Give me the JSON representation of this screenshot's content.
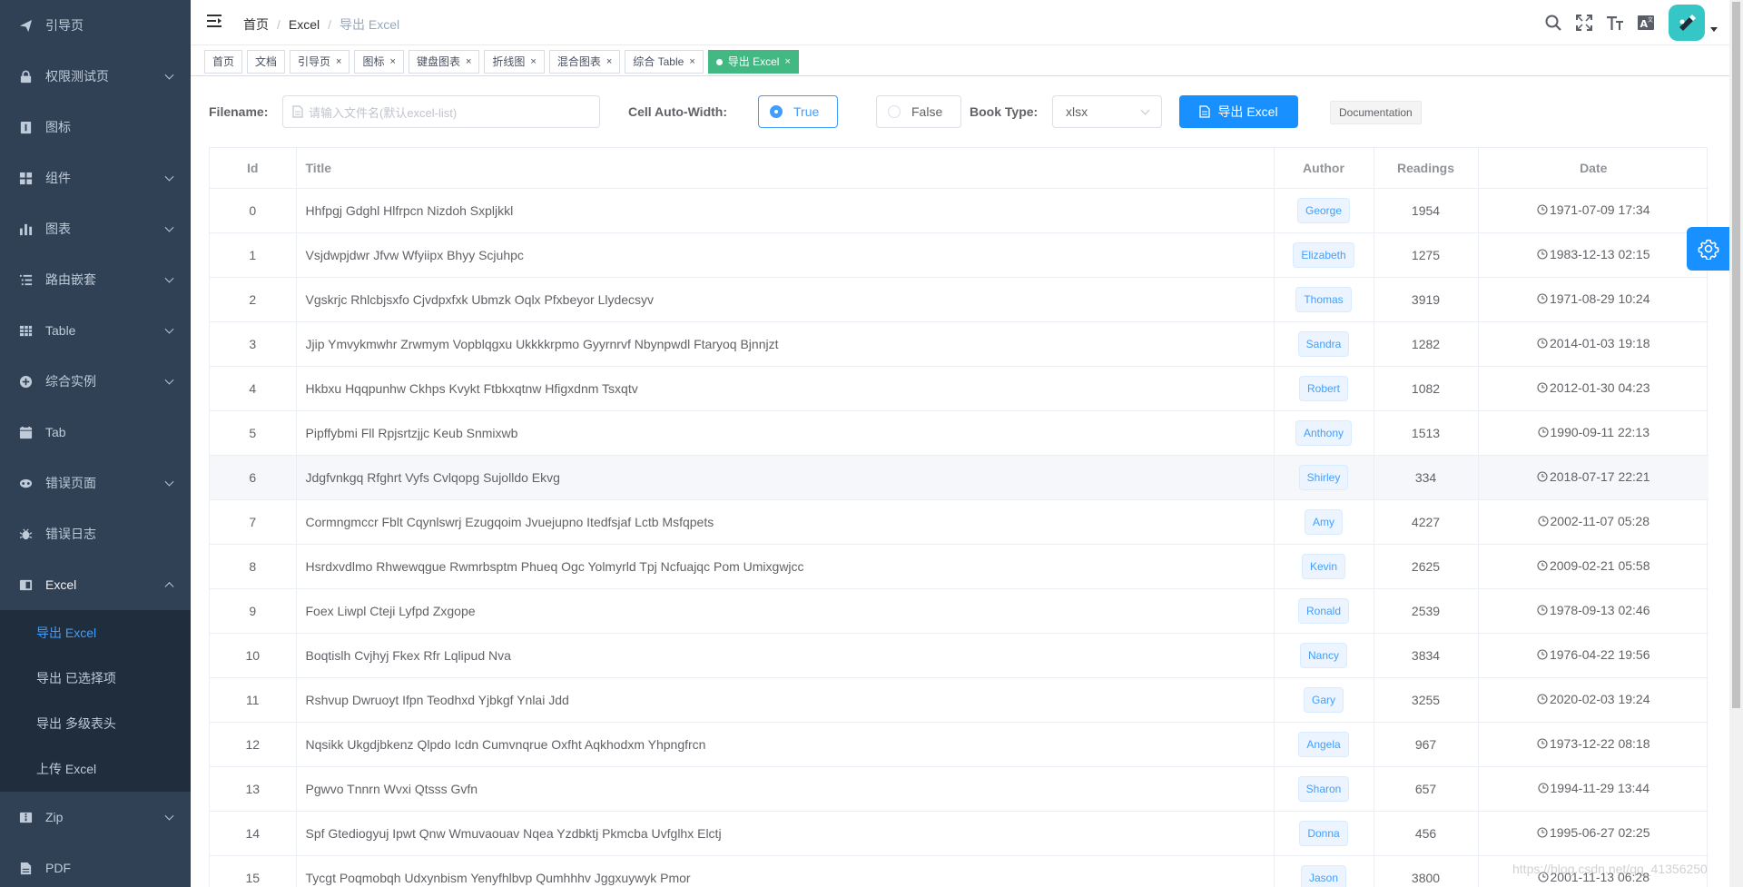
{
  "sidebar": {
    "items": [
      {
        "label": "引导页",
        "icon": "send-icon",
        "arrow": false
      },
      {
        "label": "权限测试页",
        "icon": "lock-icon",
        "arrow": true
      },
      {
        "label": "图标",
        "icon": "icon-icon",
        "arrow": false
      },
      {
        "label": "组件",
        "icon": "component-icon",
        "arrow": true
      },
      {
        "label": "图表",
        "icon": "chart-icon",
        "arrow": true
      },
      {
        "label": "路由嵌套",
        "icon": "nested-icon",
        "arrow": true
      },
      {
        "label": "Table",
        "icon": "table-icon",
        "arrow": true
      },
      {
        "label": "综合实例",
        "icon": "example-icon",
        "arrow": true
      },
      {
        "label": "Tab",
        "icon": "tab-icon",
        "arrow": false
      },
      {
        "label": "错误页面",
        "icon": "404-icon",
        "arrow": true
      },
      {
        "label": "错误日志",
        "icon": "bug-icon",
        "arrow": false
      },
      {
        "label": "Excel",
        "icon": "excel-icon",
        "arrow": true,
        "open": true
      }
    ],
    "excel_sub": [
      "导出 Excel",
      "导出 已选择项",
      "导出 多级表头",
      "上传 Excel"
    ],
    "after": [
      {
        "label": "Zip",
        "icon": "zip-icon",
        "arrow": true
      },
      {
        "label": "PDF",
        "icon": "pdf-icon",
        "arrow": false
      }
    ]
  },
  "navbar": {
    "breadcrumb": [
      "首页",
      "Excel",
      "导出 Excel"
    ]
  },
  "tags": [
    {
      "label": "首页",
      "closable": false
    },
    {
      "label": "文档",
      "closable": false
    },
    {
      "label": "引导页",
      "closable": true
    },
    {
      "label": "图标",
      "closable": true
    },
    {
      "label": "键盘图表",
      "closable": true
    },
    {
      "label": "折线图",
      "closable": true
    },
    {
      "label": "混合图表",
      "closable": true
    },
    {
      "label": "综合 Table",
      "closable": true
    },
    {
      "label": "导出 Excel",
      "closable": true,
      "active": true
    }
  ],
  "toolbar": {
    "filename_label": "Filename:",
    "filename_placeholder": "请输入文件名(默认excel-list)",
    "autowidth_label": "Cell Auto-Width:",
    "radio_true": "True",
    "radio_false": "False",
    "booktype_label": "Book Type:",
    "booktype_value": "xlsx",
    "export_button": "导出 Excel",
    "doc_button": "Documentation"
  },
  "table": {
    "headers": [
      "Id",
      "Title",
      "Author",
      "Readings",
      "Date"
    ],
    "rows": [
      {
        "id": "0",
        "title": "Hhfpgj Gdghl Hlfrpcn Nizdoh Sxpljkkl",
        "author": "George",
        "readings": "1954",
        "date": "1971-07-09 17:34"
      },
      {
        "id": "1",
        "title": "Vsjdwpjdwr Jfvw Wfyiipx Bhyy Scjuhpc",
        "author": "Elizabeth",
        "readings": "1275",
        "date": "1983-12-13 02:15"
      },
      {
        "id": "2",
        "title": "Vgskrjc Rhlcbjsxfo Cjvdpxfxk Ubmzk Oqlx Pfxbeyor Llydecsyv",
        "author": "Thomas",
        "readings": "3919",
        "date": "1971-08-29 10:24"
      },
      {
        "id": "3",
        "title": "Jjip Ymvykmwhr Zrwmym Vopblqgxu Ukkkkrpmo Gyyrnrvf Nbynpwdl Ftaryoq Bjnnjzt",
        "author": "Sandra",
        "readings": "1282",
        "date": "2014-01-03 19:18"
      },
      {
        "id": "4",
        "title": "Hkbxu Hqqpunhw Ckhps Kvykt Ftbkxqtnw Hfigxdnm Tsxqtv",
        "author": "Robert",
        "readings": "1082",
        "date": "2012-01-30 04:23"
      },
      {
        "id": "5",
        "title": "Pipffybmi Fll Rpjsrtzjjc Keub Snmixwb",
        "author": "Anthony",
        "readings": "1513",
        "date": "1990-09-11 22:13"
      },
      {
        "id": "6",
        "title": "Jdgfvnkgq Rfghrt Vyfs Cvlqopg Sujolldo Ekvg",
        "author": "Shirley",
        "readings": "334",
        "date": "2018-07-17 22:21"
      },
      {
        "id": "7",
        "title": "Cormngmccr Fblt Cqynlswrj Ezugqoim Jvuejupno Itedfsjaf Lctb Msfqpets",
        "author": "Amy",
        "readings": "4227",
        "date": "2002-11-07 05:28"
      },
      {
        "id": "8",
        "title": "Hsrdxvdlmo Rhwewqgue Rwmrbsptm Phueq Ogc Yolmyrld Tpj Ncfuajqc Pom Umixgwjcc",
        "author": "Kevin",
        "readings": "2625",
        "date": "2009-02-21 05:58"
      },
      {
        "id": "9",
        "title": "Foex Liwpl Cteji Lyfpd Zxgope",
        "author": "Ronald",
        "readings": "2539",
        "date": "1978-09-13 02:46"
      },
      {
        "id": "10",
        "title": "Boqtislh Cvjhyj Fkex Rfr Lqlipud Nva",
        "author": "Nancy",
        "readings": "3834",
        "date": "1976-04-22 19:56"
      },
      {
        "id": "11",
        "title": "Rshvup Dwruoyt Ifpn Teodhxd Yjbkgf Ynlai Jdd",
        "author": "Gary",
        "readings": "3255",
        "date": "2020-02-03 19:24"
      },
      {
        "id": "12",
        "title": "Nqsikk Ukgdjbkenz Qlpdo Icdn Cumvnqrue Oxfht Aqkhodxm Yhpngfrcn",
        "author": "Angela",
        "readings": "967",
        "date": "1973-12-22 08:18"
      },
      {
        "id": "13",
        "title": "Pgwvo Tnnrn Wvxi Qtsss Gvfn",
        "author": "Sharon",
        "readings": "657",
        "date": "1994-11-29 13:44"
      },
      {
        "id": "14",
        "title": "Spf Gtediogyuj Ipwt Qnw Wmuvaouav Nqea Yzdbktj Pkmcba Uvfglhx Elctj",
        "author": "Donna",
        "readings": "456",
        "date": "1995-06-27 02:25"
      },
      {
        "id": "15",
        "title": "Tycgt Poqmobqh Udxynbism Yenyfhlbvp Qumhhhv Jggxuywyk Pmor",
        "author": "Jason",
        "readings": "3800",
        "date": "2001-11-13 06:28"
      }
    ]
  },
  "watermark": "https://blog.csdn.net/qq_41356250",
  "colors": {
    "sidebar_bg": "#304156",
    "submenu_bg": "#1f2d3d",
    "primary": "#1890ff",
    "tag_active": "#42b983"
  }
}
